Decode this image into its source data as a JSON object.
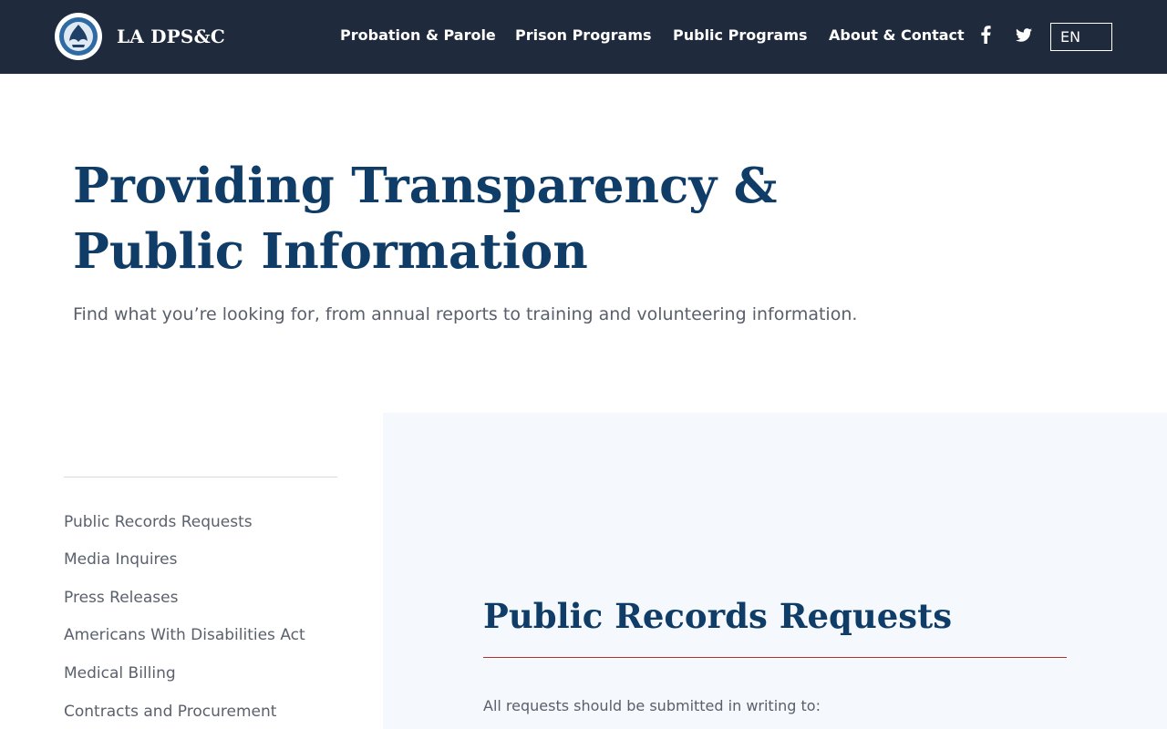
{
  "header": {
    "brand": "LA DPS&C",
    "nav": [
      {
        "label": "Probation & Parole"
      },
      {
        "label": "Prison Programs"
      },
      {
        "label": "Public Programs"
      },
      {
        "label": "About & Contact"
      }
    ],
    "social": [
      "facebook-icon",
      "twitter-icon"
    ],
    "language": "EN"
  },
  "hero": {
    "title": "Providing Transparency & Public Information",
    "subtitle": "Find what you’re looking for, from annual reports to training and volunteering information."
  },
  "sidebar": {
    "items": [
      {
        "label": "Public Records Requests"
      },
      {
        "label": "Media Inquires"
      },
      {
        "label": "Press Releases"
      },
      {
        "label": "Americans With Disabilities Act"
      },
      {
        "label": "Medical Billing"
      },
      {
        "label": "Contracts and Procurement"
      }
    ]
  },
  "content": {
    "heading": "Public Records Requests",
    "intro": "All requests should be submitted in writing to:"
  },
  "colors": {
    "header_bg": "#1f2a3c",
    "heading": "#0f3d67",
    "body_text": "#59606b",
    "panel_bg": "#f5f8fc",
    "accent_rule": "#b3332f"
  }
}
